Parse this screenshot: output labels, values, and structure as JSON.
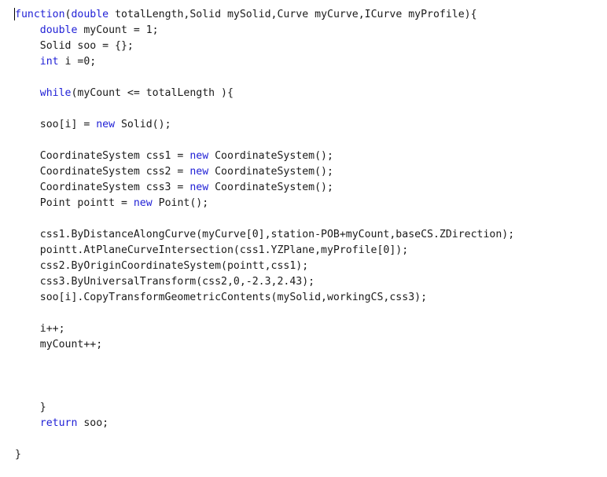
{
  "editor": {
    "kind": "code-editor",
    "language": "code",
    "background_color": "#ffffff",
    "text_color": "#1a1a1a",
    "keyword_color": "#1f1fd6",
    "font_size_px": 13,
    "line_height_px": 20,
    "caret": {
      "visible": true,
      "line": 1,
      "column": 1
    }
  },
  "code": {
    "lines": [
      [
        {
          "t": "function",
          "c": "kw"
        },
        {
          "t": "(",
          "c": "id"
        },
        {
          "t": "double",
          "c": "kw"
        },
        {
          "t": " totalLength,Solid mySolid,Curve myCurve,ICurve myProfile){",
          "c": "id"
        }
      ],
      [
        {
          "t": "    ",
          "c": "id"
        },
        {
          "t": "double",
          "c": "kw"
        },
        {
          "t": " myCount = 1;",
          "c": "id"
        }
      ],
      [
        {
          "t": "    Solid soo = {};",
          "c": "id"
        }
      ],
      [
        {
          "t": "    ",
          "c": "id"
        },
        {
          "t": "int",
          "c": "kw"
        },
        {
          "t": " i =0;",
          "c": "id"
        }
      ],
      [],
      [
        {
          "t": "    ",
          "c": "id"
        },
        {
          "t": "while",
          "c": "kw"
        },
        {
          "t": "(myCount <= totalLength ){",
          "c": "id"
        }
      ],
      [],
      [
        {
          "t": "    soo[i] = ",
          "c": "id"
        },
        {
          "t": "new",
          "c": "kw"
        },
        {
          "t": " Solid();",
          "c": "id"
        }
      ],
      [],
      [
        {
          "t": "    CoordinateSystem css1 = ",
          "c": "id"
        },
        {
          "t": "new",
          "c": "kw"
        },
        {
          "t": " CoordinateSystem();",
          "c": "id"
        }
      ],
      [
        {
          "t": "    CoordinateSystem css2 = ",
          "c": "id"
        },
        {
          "t": "new",
          "c": "kw"
        },
        {
          "t": " CoordinateSystem();",
          "c": "id"
        }
      ],
      [
        {
          "t": "    CoordinateSystem css3 = ",
          "c": "id"
        },
        {
          "t": "new",
          "c": "kw"
        },
        {
          "t": " CoordinateSystem();",
          "c": "id"
        }
      ],
      [
        {
          "t": "    Point pointt = ",
          "c": "id"
        },
        {
          "t": "new",
          "c": "kw"
        },
        {
          "t": " Point();",
          "c": "id"
        }
      ],
      [],
      [
        {
          "t": "    css1.ByDistanceAlongCurve(myCurve[0],station-POB+myCount,baseCS.ZDirection);",
          "c": "id"
        }
      ],
      [
        {
          "t": "    pointt.AtPlaneCurveIntersection(css1.YZPlane,myProfile[0]);",
          "c": "id"
        }
      ],
      [
        {
          "t": "    css2.ByOriginCoordinateSystem(pointt,css1);",
          "c": "id"
        }
      ],
      [
        {
          "t": "    css3.ByUniversalTransform(css2,0,-2.3,2.43);",
          "c": "id"
        }
      ],
      [
        {
          "t": "    soo[i].CopyTransformGeometricContents(mySolid,workingCS,css3);",
          "c": "id"
        }
      ],
      [],
      [
        {
          "t": "    i++;",
          "c": "id"
        }
      ],
      [
        {
          "t": "    myCount++;",
          "c": "id"
        }
      ],
      [],
      [],
      [],
      [
        {
          "t": "    }",
          "c": "id"
        }
      ],
      [
        {
          "t": "    ",
          "c": "id"
        },
        {
          "t": "return",
          "c": "kw"
        },
        {
          "t": " soo;",
          "c": "id"
        }
      ],
      [],
      [
        {
          "t": "}",
          "c": "id"
        }
      ]
    ]
  }
}
